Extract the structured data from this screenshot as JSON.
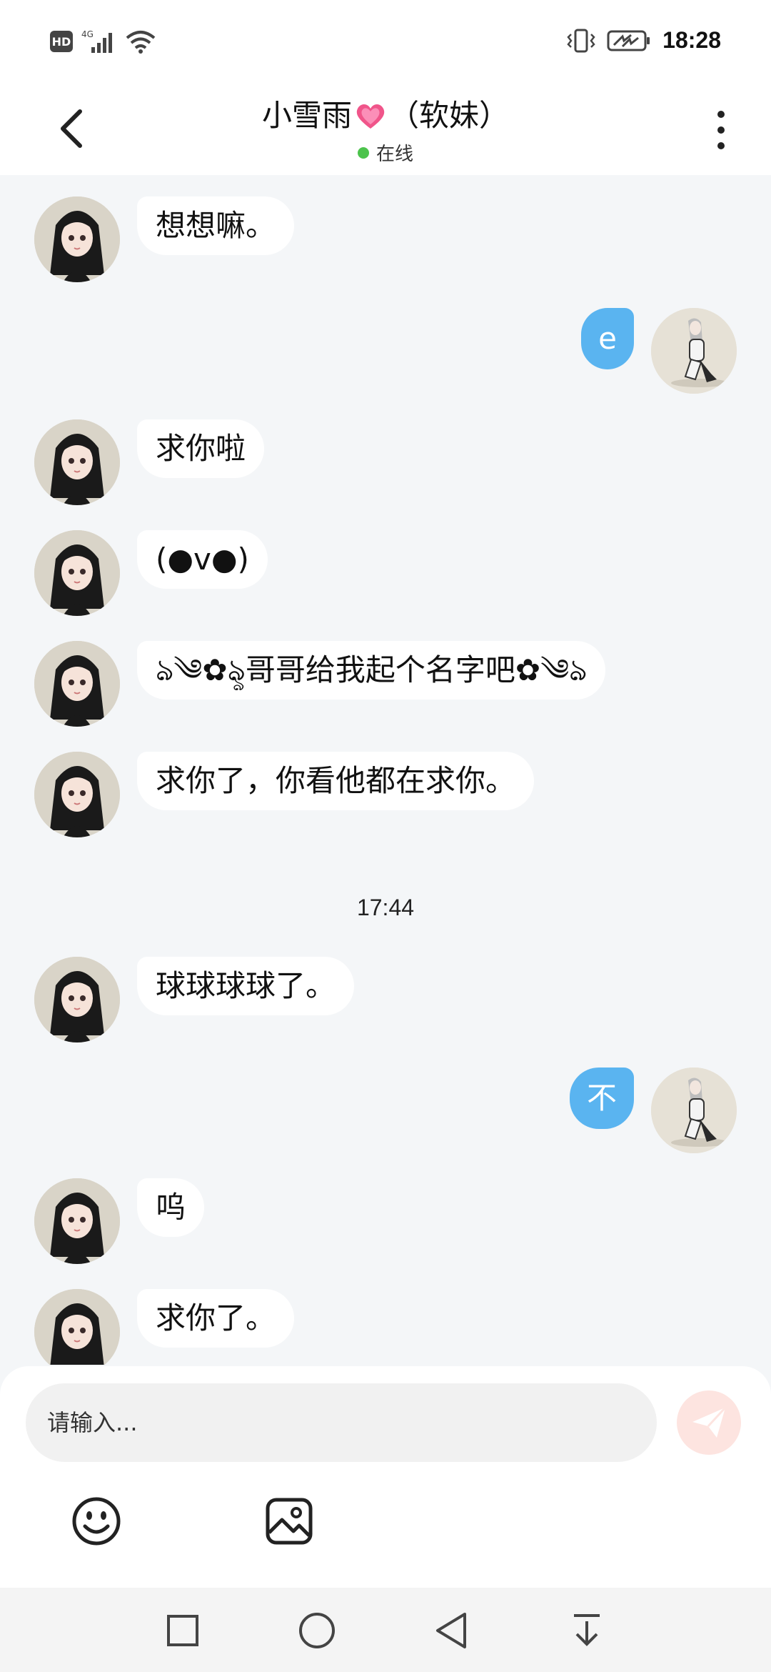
{
  "status_bar": {
    "network_badge": "HD",
    "network_type": "4G",
    "time": "18:28",
    "icons": [
      "signal-icon",
      "wifi-icon",
      "vibrate-icon",
      "battery-icon"
    ]
  },
  "header": {
    "title_name": "小雪雨",
    "title_suffix": "（软妹）",
    "status": "在线",
    "status_color": "#4cc34c"
  },
  "messages": [
    {
      "side": "left",
      "text": "想想嘛。"
    },
    {
      "side": "right",
      "text": "e"
    },
    {
      "side": "left",
      "text": "求你啦"
    },
    {
      "side": "left",
      "text": "(●v●)"
    },
    {
      "side": "left",
      "text": "ঌ༄✿ৡ哥哥给我起个名字吧✿༄ঌ"
    },
    {
      "side": "left",
      "text": "求你了，你看他都在求你。"
    },
    {
      "type": "time",
      "text": "17:44"
    },
    {
      "side": "left",
      "text": "球球球球了。"
    },
    {
      "side": "right",
      "text": "不"
    },
    {
      "side": "left",
      "text": "呜"
    },
    {
      "side": "left",
      "text": "求你了。"
    }
  ],
  "input": {
    "placeholder": "请输入..."
  },
  "colors": {
    "accent_blue": "#5ab4f0",
    "send_button": "#fde4e0",
    "background": "#f4f6f8"
  }
}
